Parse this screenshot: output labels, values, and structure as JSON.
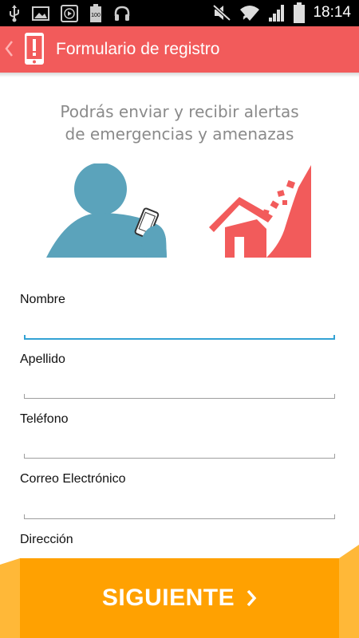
{
  "status_bar": {
    "time": "18:14",
    "left_icons": [
      "usb-icon",
      "image-icon",
      "media-icon",
      "battery-saver-icon",
      "headphones-icon"
    ],
    "right_icons": [
      "mute-icon",
      "wifi-icon",
      "signal-icon",
      "battery-icon"
    ]
  },
  "app_bar": {
    "title": "Formulario de registro",
    "color": "#f25b5b"
  },
  "intro": {
    "line1": "Podrás enviar y recibir alertas",
    "line2": "de emergencias y amenazas"
  },
  "form": {
    "fields": [
      {
        "label": "Nombre",
        "value": ""
      },
      {
        "label": "Apellido",
        "value": ""
      },
      {
        "label": "Teléfono",
        "value": ""
      },
      {
        "label": "Correo Electrónico",
        "value": ""
      },
      {
        "label": "Dirección",
        "value": ""
      }
    ],
    "focus_color": "#33a2d4"
  },
  "button": {
    "label": "SIGUIENTE",
    "color": "#ffa101"
  },
  "illustrations": {
    "person_color": "#5ba3bb",
    "house_color": "#f25b5b"
  }
}
